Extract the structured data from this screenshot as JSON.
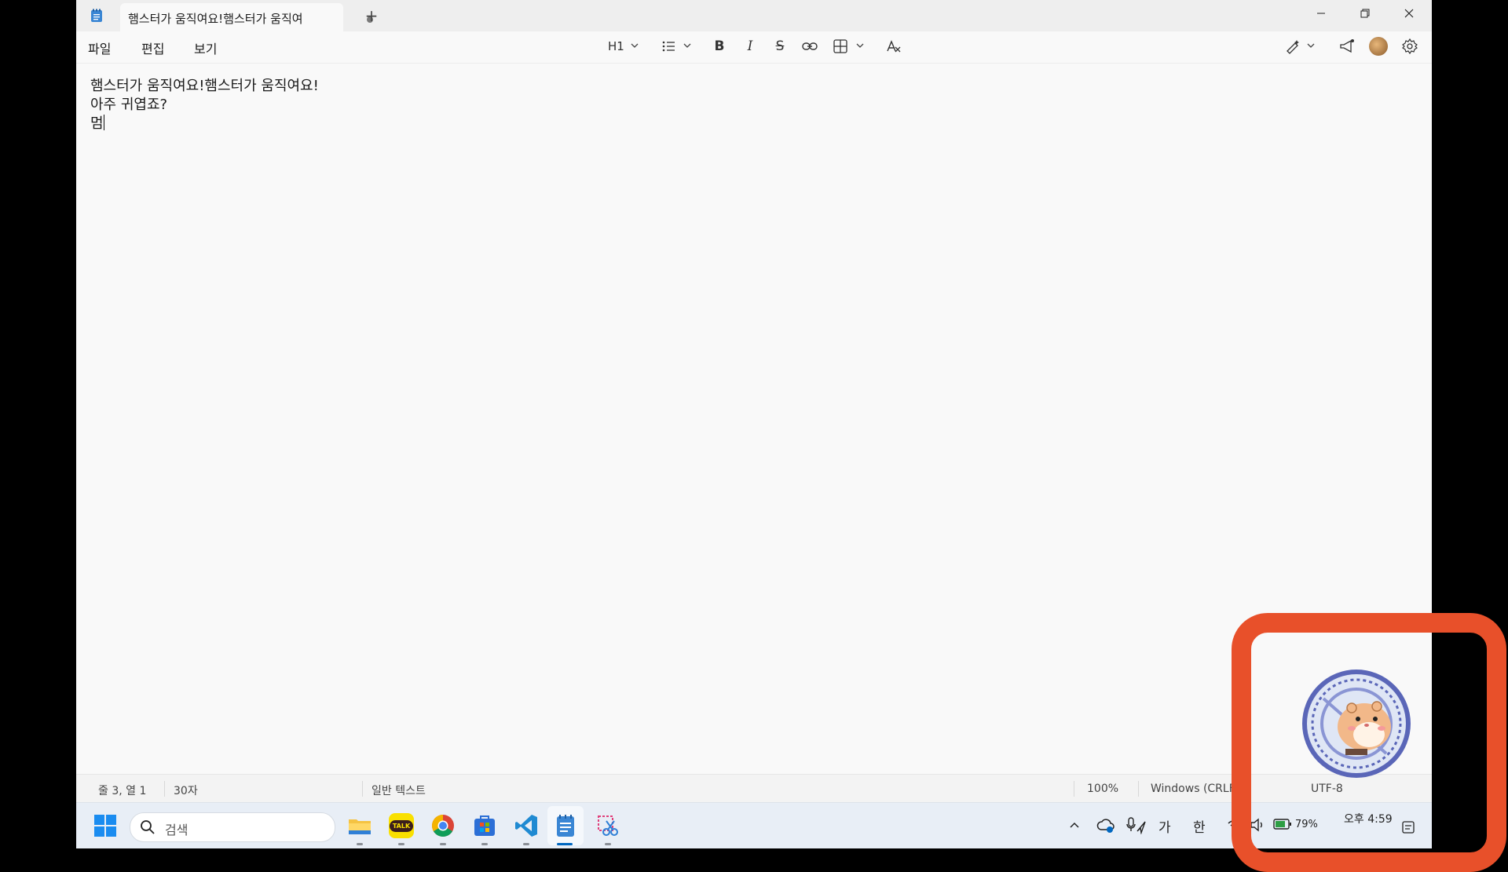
{
  "window": {
    "tab_title": "햄스터가 움직여요!햄스터가 움직여",
    "new_tab_label": "+"
  },
  "menu": {
    "file": "파일",
    "edit": "편집",
    "view": "보기"
  },
  "toolbar": {
    "heading_label": "H1"
  },
  "editor": {
    "lines": [
      "햄스터가 움직여요!햄스터가 움직여요!",
      "아주 귀엽죠?",
      "멈"
    ]
  },
  "status": {
    "position": "줄 3, 열 1",
    "char_count": "30자",
    "format": "일반 텍스트",
    "zoom": "100%",
    "line_ending": "Windows (CRLF",
    "encoding": "UTF-8"
  },
  "taskbar": {
    "search_placeholder": "검색",
    "apps": [
      "file-explorer-icon",
      "kakaotalk-icon",
      "chrome-icon",
      "store-icon",
      "vscode-icon",
      "notepad-icon",
      "snipping-tool-icon"
    ],
    "kakaotalk_badge": "TALK",
    "ime_mode": "가",
    "ime_lang": "한",
    "battery": "79%",
    "clock": "오후 4:59"
  },
  "colors": {
    "highlight": "#e8502a",
    "accent": "#0067c0"
  }
}
